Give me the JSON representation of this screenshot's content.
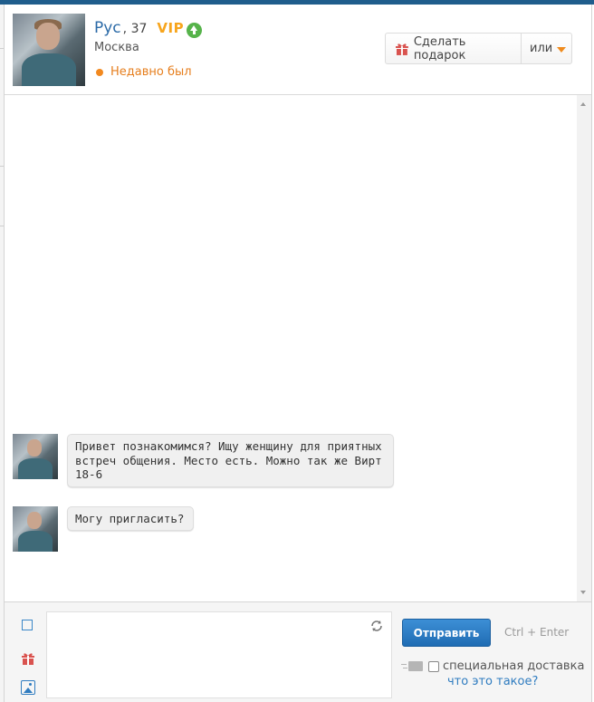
{
  "profile": {
    "name": "Рус",
    "age": ", 37",
    "vip": "VIP",
    "city": "Москва",
    "status": "Недавно был"
  },
  "actions": {
    "gift_label": "Сделать подарок",
    "or_label": "или"
  },
  "messages": [
    {
      "text": "Привет познакомимся? Ищу женщину для приятных встреч общения. Место есть. Можно так же Вирт 18-6"
    },
    {
      "text": "Могу пригласить?"
    }
  ],
  "composer": {
    "message_value": "",
    "send_label": "Отправить",
    "hint": "Ctrl + Enter",
    "special_delivery_label": "специальная доставка",
    "special_delivery_checked": false,
    "what_is_this_link": "что это такое?"
  },
  "icons": {
    "status_dot": "online-status-dot",
    "vip_boost": "up-arrow-circle-icon",
    "gift": "gift-icon",
    "dropdown": "chevron-down-icon",
    "refresh": "refresh-icon",
    "sticker": "square-icon",
    "photo": "image-icon",
    "envelope": "envelope-icon"
  },
  "colors": {
    "accent_blue": "#2b6aa7",
    "vip_orange": "#f7a51d",
    "status_orange": "#e67e1d",
    "send_button": "#2a7bc4"
  }
}
